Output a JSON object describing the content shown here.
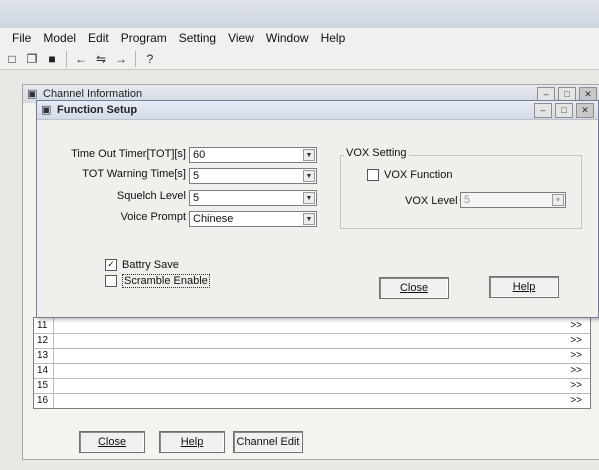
{
  "menu": [
    "File",
    "Model",
    "Edit",
    "Program",
    "Setting",
    "View",
    "Window",
    "Help"
  ],
  "toolbar": {
    "icons": [
      "new-file-icon",
      "open-folder-icon",
      "save-icon",
      "back-arrow-icon",
      "read-radio-icon",
      "forward-arrow-icon",
      "help-icon"
    ],
    "glyphs": [
      "□",
      "❐",
      "■",
      "←",
      "⇋",
      "→",
      "?"
    ]
  },
  "channel_window": {
    "title": "Channel Information",
    "window_buttons": [
      "–",
      "□",
      "✕"
    ],
    "rows": [
      {
        "num": "11",
        "arrow": ">>"
      },
      {
        "num": "12",
        "arrow": ">>"
      },
      {
        "num": "13",
        "arrow": ">>"
      },
      {
        "num": "14",
        "arrow": ">>"
      },
      {
        "num": "15",
        "arrow": ">>"
      },
      {
        "num": "16",
        "arrow": ">>"
      }
    ],
    "buttons": {
      "close": "Close",
      "help": "Help",
      "channel_edit": "Channel Edit"
    }
  },
  "function_setup": {
    "title": "Function Setup",
    "window_buttons": [
      "–",
      "□",
      "✕"
    ],
    "fields": {
      "tot": {
        "label": "Time Out Timer[TOT][s]",
        "value": "60"
      },
      "tot_warning": {
        "label": "TOT Warning Time[s]",
        "value": "5"
      },
      "squelch": {
        "label": "Squelch Level",
        "value": "5"
      },
      "voice_prompt": {
        "label": "Voice Prompt",
        "value": "Chinese"
      }
    },
    "checkboxes": {
      "battery_save": {
        "label": "Battry Save",
        "checked_mark": "✓"
      },
      "scramble": {
        "label": "Scramble Enable"
      }
    },
    "vox": {
      "group_label": "VOX Setting",
      "function_label": "VOX Function",
      "level_label": "VOX Level",
      "level_value": "5"
    },
    "buttons": {
      "close": "Close",
      "help": "Help"
    }
  },
  "glyphs": {
    "window_icon": "▣",
    "dropdown": "▼"
  }
}
